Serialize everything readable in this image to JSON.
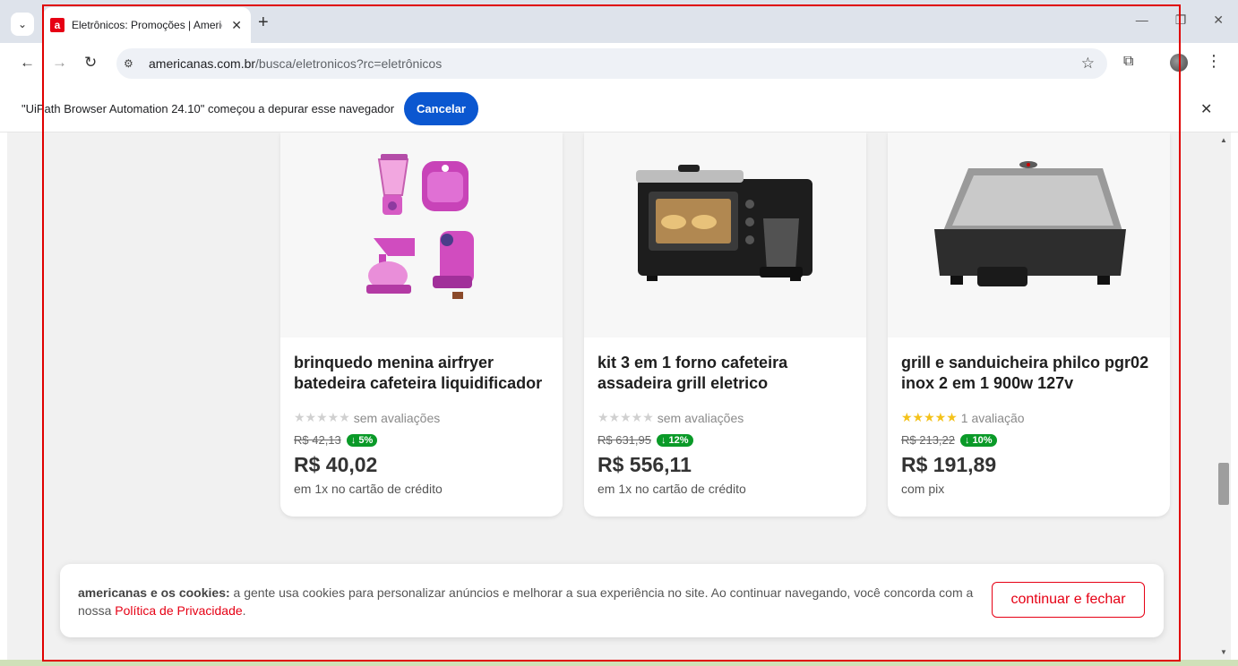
{
  "browser": {
    "tab_title": "Eletrônicos: Promoções | Americanas",
    "favicon_letter": "a",
    "url_domain": "americanas.com.br",
    "url_path": "/busca/eletronicos?rc=eletrônicos"
  },
  "infobar": {
    "message": "\"UiPath Browser Automation 24.10\" começou a depurar esse navegador",
    "cancel_label": "Cancelar"
  },
  "products": [
    {
      "title": "brinquedo menina airfryer batedeira cafeteira liquidificador",
      "stars": "★★★★★",
      "rating_text": "sem avaliações",
      "rating_stars": 0,
      "old_price": "R$ 42,13",
      "discount": "↓ 5%",
      "price": "R$ 40,02",
      "payment": "em 1x no cartão de crédito"
    },
    {
      "title": "kit 3 em 1 forno cafeteira assadeira grill eletrico",
      "stars": "★★★★★",
      "rating_text": "sem avaliações",
      "rating_stars": 0,
      "old_price": "R$ 631,95",
      "discount": "↓ 12%",
      "price": "R$ 556,11",
      "payment": "em 1x no cartão de crédito"
    },
    {
      "title": "grill e sanduicheira philco pgr02 inox 2 em 1 900w 127v",
      "stars": "★★★★★",
      "rating_text": "1 avaliação",
      "rating_stars": 5,
      "old_price": "R$ 213,22",
      "discount": "↓ 10%",
      "price": "R$ 191,89",
      "payment": "com pix"
    }
  ],
  "cookie": {
    "bold": "americanas e os cookies:",
    "text": " a gente usa cookies para personalizar anúncios e melhorar a sua experiência no site. Ao continuar navegando, você concorda com a nossa ",
    "link": "Política de Privacidade",
    "end": ".",
    "button": "continuar e fechar"
  },
  "colors": {
    "brand": "#e60014",
    "discount_badge": "#0a9a28",
    "cancel_button": "#0b57d0"
  }
}
